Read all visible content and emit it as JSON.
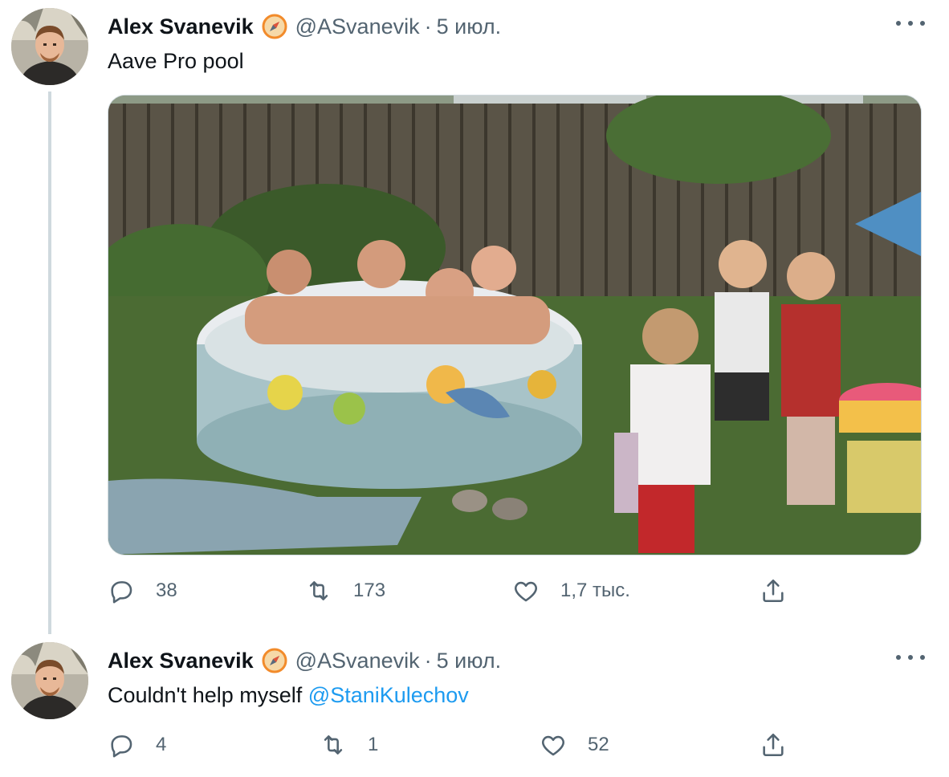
{
  "tweets": [
    {
      "author_name": "Alex Svanevik",
      "handle": "@ASvanevik",
      "separator": "·",
      "date": "5 июл.",
      "text": "Aave Pro pool",
      "media": {
        "description_icon": "photo-pool-icon"
      },
      "actions": {
        "replies": "38",
        "retweets": "173",
        "likes": "1,7 тыс."
      }
    },
    {
      "author_name": "Alex Svanevik",
      "handle": "@ASvanevik",
      "separator": "·",
      "date": "5 июл.",
      "text": "Couldn't help myself ",
      "mention": "@StaniKulechov",
      "actions": {
        "replies": "4",
        "retweets": "1",
        "likes": "52"
      }
    }
  ],
  "colors": {
    "accent": "#1d9bf0",
    "secondary_text": "#536471",
    "thread_line": "#cfd9de",
    "verified_badge": "#f28b2b"
  }
}
